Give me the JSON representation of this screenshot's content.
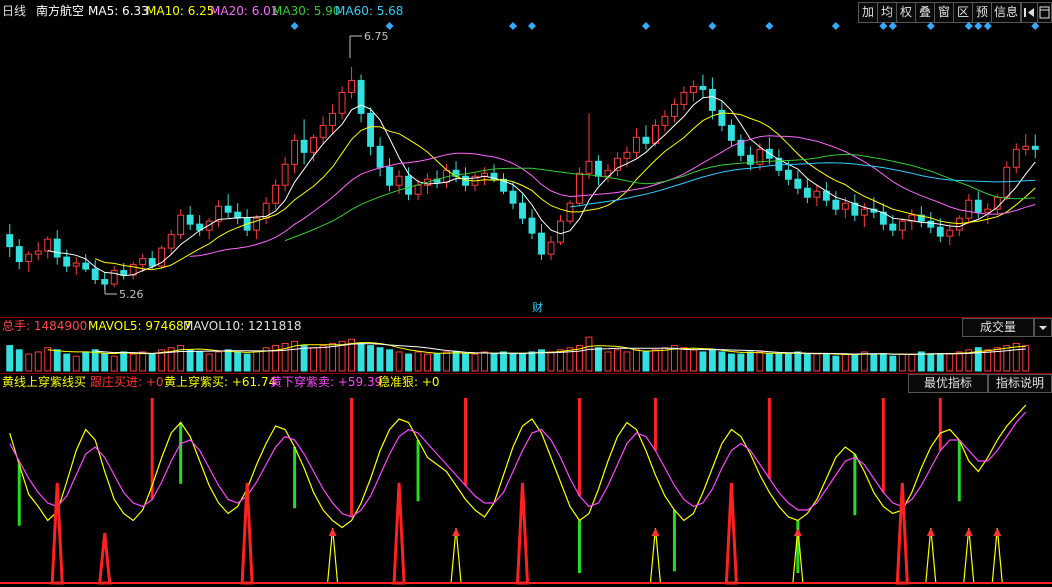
{
  "window": {
    "period": "日线",
    "stock_name": "南方航空"
  },
  "ma_legend": [
    {
      "label": "MA5: 6.33",
      "color": "#ffffff"
    },
    {
      "label": "MA10: 6.25",
      "color": "#ffff00"
    },
    {
      "label": "MA20: 6.01",
      "color": "#ff66ff"
    },
    {
      "label": "MA30: 5.90",
      "color": "#33cc33"
    },
    {
      "label": "MA60: 5.68",
      "color": "#33ccff"
    }
  ],
  "toolbar": {
    "add_label": "加",
    "avg_label": "均",
    "rights_label": "权",
    "overlay_label": "叠",
    "window_label": "窗",
    "range_label": "区",
    "forecast_label": "预",
    "info_label": "信息"
  },
  "chart_data": [
    {
      "type": "candlestick",
      "title": "南方航空",
      "annotations": [
        "6.75",
        "5.26",
        "财"
      ],
      "price_labels": {
        "high": "6.75",
        "low": "5.26"
      },
      "event_marker": "财",
      "ohlc": [
        [
          5.63,
          5.7,
          5.48,
          5.55
        ],
        [
          5.55,
          5.6,
          5.4,
          5.45
        ],
        [
          5.45,
          5.52,
          5.38,
          5.5
        ],
        [
          5.5,
          5.58,
          5.46,
          5.52
        ],
        [
          5.52,
          5.62,
          5.47,
          5.6
        ],
        [
          5.6,
          5.66,
          5.43,
          5.48
        ],
        [
          5.48,
          5.53,
          5.38,
          5.42
        ],
        [
          5.42,
          5.48,
          5.36,
          5.44
        ],
        [
          5.44,
          5.5,
          5.38,
          5.4
        ],
        [
          5.4,
          5.46,
          5.3,
          5.33
        ],
        [
          5.33,
          5.38,
          5.26,
          5.3
        ],
        [
          5.3,
          5.42,
          5.28,
          5.39
        ],
        [
          5.39,
          5.44,
          5.33,
          5.36
        ],
        [
          5.36,
          5.45,
          5.33,
          5.43
        ],
        [
          5.43,
          5.5,
          5.38,
          5.47
        ],
        [
          5.47,
          5.52,
          5.4,
          5.42
        ],
        [
          5.42,
          5.56,
          5.4,
          5.54
        ],
        [
          5.54,
          5.66,
          5.5,
          5.63
        ],
        [
          5.63,
          5.8,
          5.6,
          5.76
        ],
        [
          5.76,
          5.82,
          5.66,
          5.7
        ],
        [
          5.7,
          5.76,
          5.62,
          5.66
        ],
        [
          5.66,
          5.74,
          5.6,
          5.72
        ],
        [
          5.72,
          5.86,
          5.68,
          5.82
        ],
        [
          5.82,
          5.9,
          5.74,
          5.78
        ],
        [
          5.78,
          5.84,
          5.7,
          5.74
        ],
        [
          5.74,
          5.8,
          5.62,
          5.66
        ],
        [
          5.66,
          5.76,
          5.6,
          5.74
        ],
        [
          5.74,
          5.88,
          5.7,
          5.84
        ],
        [
          5.84,
          6.0,
          5.8,
          5.96
        ],
        [
          5.96,
          6.15,
          5.92,
          6.1
        ],
        [
          6.1,
          6.3,
          6.04,
          6.26
        ],
        [
          6.26,
          6.4,
          6.1,
          6.18
        ],
        [
          6.18,
          6.3,
          6.12,
          6.28
        ],
        [
          6.28,
          6.42,
          6.24,
          6.36
        ],
        [
          6.36,
          6.5,
          6.3,
          6.44
        ],
        [
          6.44,
          6.62,
          6.4,
          6.58
        ],
        [
          6.58,
          6.75,
          6.54,
          6.66
        ],
        [
          6.66,
          6.7,
          6.38,
          6.44
        ],
        [
          6.44,
          6.48,
          6.16,
          6.22
        ],
        [
          6.22,
          6.28,
          6.02,
          6.08
        ],
        [
          6.08,
          6.14,
          5.92,
          5.96
        ],
        [
          5.96,
          6.06,
          5.9,
          6.02
        ],
        [
          6.02,
          6.08,
          5.86,
          5.9
        ],
        [
          5.9,
          6.0,
          5.86,
          5.96
        ],
        [
          5.96,
          6.04,
          5.9,
          6.0
        ],
        [
          6.0,
          6.06,
          5.94,
          5.98
        ],
        [
          5.98,
          6.1,
          5.94,
          6.06
        ],
        [
          6.06,
          6.12,
          5.98,
          6.02
        ],
        [
          6.02,
          6.08,
          5.92,
          5.96
        ],
        [
          5.96,
          6.04,
          5.92,
          6.02
        ],
        [
          6.02,
          6.08,
          5.96,
          6.04
        ],
        [
          6.04,
          6.1,
          5.98,
          6.0
        ],
        [
          6.0,
          6.04,
          5.9,
          5.92
        ],
        [
          5.92,
          5.98,
          5.8,
          5.84
        ],
        [
          5.84,
          5.9,
          5.7,
          5.74
        ],
        [
          5.74,
          5.8,
          5.6,
          5.64
        ],
        [
          5.64,
          5.7,
          5.46,
          5.5
        ],
        [
          5.5,
          5.62,
          5.46,
          5.58
        ],
        [
          5.58,
          5.76,
          5.56,
          5.72
        ],
        [
          5.72,
          5.86,
          5.7,
          5.84
        ],
        [
          5.84,
          6.08,
          5.82,
          6.04
        ],
        [
          6.04,
          6.44,
          6.0,
          6.12
        ],
        [
          6.12,
          6.16,
          5.96,
          6.02
        ],
        [
          6.02,
          6.1,
          5.98,
          6.06
        ],
        [
          6.06,
          6.18,
          6.02,
          6.14
        ],
        [
          6.14,
          6.22,
          6.08,
          6.18
        ],
        [
          6.18,
          6.34,
          6.14,
          6.28
        ],
        [
          6.28,
          6.36,
          6.2,
          6.24
        ],
        [
          6.24,
          6.4,
          6.22,
          6.36
        ],
        [
          6.36,
          6.46,
          6.32,
          6.42
        ],
        [
          6.42,
          6.54,
          6.38,
          6.5
        ],
        [
          6.5,
          6.62,
          6.46,
          6.58
        ],
        [
          6.58,
          6.66,
          6.52,
          6.62
        ],
        [
          6.62,
          6.7,
          6.54,
          6.6
        ],
        [
          6.6,
          6.68,
          6.4,
          6.46
        ],
        [
          6.46,
          6.52,
          6.32,
          6.36
        ],
        [
          6.36,
          6.4,
          6.22,
          6.26
        ],
        [
          6.26,
          6.3,
          6.12,
          6.16
        ],
        [
          6.16,
          6.22,
          6.06,
          6.1
        ],
        [
          6.1,
          6.24,
          6.06,
          6.2
        ],
        [
          6.2,
          6.28,
          6.1,
          6.14
        ],
        [
          6.14,
          6.2,
          6.02,
          6.06
        ],
        [
          6.06,
          6.12,
          5.96,
          6.0
        ],
        [
          6.0,
          6.06,
          5.9,
          5.94
        ],
        [
          5.94,
          6.0,
          5.84,
          5.88
        ],
        [
          5.88,
          5.96,
          5.82,
          5.92
        ],
        [
          5.92,
          5.98,
          5.82,
          5.86
        ],
        [
          5.86,
          5.92,
          5.76,
          5.8
        ],
        [
          5.8,
          5.88,
          5.74,
          5.84
        ],
        [
          5.84,
          5.9,
          5.72,
          5.76
        ],
        [
          5.76,
          5.84,
          5.68,
          5.8
        ],
        [
          5.8,
          5.88,
          5.74,
          5.78
        ],
        [
          5.78,
          5.84,
          5.66,
          5.7
        ],
        [
          5.7,
          5.76,
          5.62,
          5.66
        ],
        [
          5.66,
          5.74,
          5.6,
          5.72
        ],
        [
          5.72,
          5.8,
          5.66,
          5.76
        ],
        [
          5.76,
          5.82,
          5.68,
          5.72
        ],
        [
          5.72,
          5.78,
          5.64,
          5.68
        ],
        [
          5.68,
          5.74,
          5.58,
          5.62
        ],
        [
          5.62,
          5.7,
          5.56,
          5.66
        ],
        [
          5.66,
          5.76,
          5.62,
          5.74
        ],
        [
          5.74,
          5.9,
          5.7,
          5.86
        ],
        [
          5.86,
          5.92,
          5.74,
          5.78
        ],
        [
          5.78,
          5.84,
          5.7,
          5.8
        ],
        [
          5.8,
          5.9,
          5.76,
          5.88
        ],
        [
          5.88,
          6.12,
          5.86,
          6.08
        ],
        [
          6.08,
          6.24,
          6.04,
          6.2
        ],
        [
          6.2,
          6.3,
          6.16,
          6.22
        ],
        [
          6.22,
          6.3,
          6.14,
          6.2
        ]
      ]
    },
    {
      "type": "bar",
      "title": "成交量",
      "legend": {
        "total_label": "总手: 1484900",
        "mavol5_label": "MAVOL5: 974687",
        "mavol10_label": "MAVOL10: 1211818",
        "selector_label": "成交量"
      },
      "values": [
        12,
        10,
        8,
        9,
        11,
        10,
        8,
        7,
        9,
        10,
        8,
        7,
        9,
        8,
        9,
        8,
        10,
        11,
        12,
        10,
        9,
        8,
        9,
        10,
        9,
        8,
        9,
        11,
        12,
        13,
        14,
        12,
        11,
        12,
        13,
        14,
        15,
        13,
        12,
        11,
        10,
        9,
        8,
        9,
        8,
        8,
        9,
        9,
        8,
        8,
        9,
        8,
        9,
        8,
        8,
        9,
        10,
        9,
        10,
        11,
        12,
        16,
        11,
        9,
        10,
        9,
        10,
        9,
        10,
        11,
        12,
        11,
        10,
        9,
        10,
        9,
        8,
        8,
        9,
        9,
        8,
        8,
        8,
        9,
        8,
        8,
        8,
        7,
        8,
        8,
        9,
        8,
        8,
        7,
        8,
        8,
        9,
        8,
        8,
        8,
        9,
        10,
        11,
        10,
        11,
        12,
        13,
        12
      ]
    },
    {
      "type": "line",
      "title": "黄线上穿紫线买",
      "legend": {
        "title_label": "黄线上穿紫线买",
        "follow_label": "跟庄买进: +0",
        "yellow_cross_label": "黄上穿紫买: +61.74",
        "yellow_down_label": "黄下穿紫卖: +59.39",
        "steady_label": "稳准狠: +0",
        "best_button": "最优指标",
        "help_button": "指标说明"
      },
      "series": [
        {
          "name": "黄线上穿紫线买",
          "color": "#ffff00",
          "values": [
            80,
            62,
            45,
            38,
            30,
            35,
            52,
            70,
            82,
            76,
            58,
            42,
            34,
            30,
            36,
            50,
            66,
            80,
            86,
            78,
            64,
            50,
            40,
            34,
            38,
            48,
            62,
            74,
            84,
            82,
            72,
            60,
            46,
            36,
            30,
            26,
            30,
            40,
            54,
            70,
            82,
            88,
            86,
            76,
            66,
            62,
            58,
            50,
            42,
            36,
            32,
            40,
            56,
            72,
            84,
            88,
            80,
            66,
            52,
            38,
            30,
            34,
            48,
            64,
            78,
            86,
            82,
            70,
            56,
            44,
            36,
            30,
            34,
            46,
            60,
            74,
            82,
            78,
            68,
            56,
            46,
            38,
            32,
            30,
            34,
            42,
            54,
            66,
            72,
            68,
            58,
            46,
            38,
            34,
            36,
            46,
            60,
            72,
            80,
            82,
            76,
            64,
            58,
            66,
            76,
            84,
            90,
            96
          ]
        },
        {
          "name": "紫线",
          "color": "#ff44ff",
          "values": [
            74,
            64,
            54,
            46,
            40,
            38,
            44,
            56,
            68,
            72,
            66,
            56,
            46,
            40,
            38,
            42,
            52,
            64,
            74,
            76,
            70,
            60,
            50,
            42,
            40,
            44,
            52,
            62,
            72,
            78,
            76,
            68,
            58,
            48,
            40,
            34,
            32,
            36,
            44,
            56,
            68,
            78,
            82,
            80,
            74,
            68,
            62,
            56,
            50,
            44,
            40,
            40,
            46,
            58,
            70,
            80,
            82,
            76,
            66,
            54,
            44,
            38,
            40,
            50,
            62,
            74,
            80,
            78,
            70,
            60,
            50,
            42,
            38,
            40,
            48,
            60,
            70,
            74,
            70,
            62,
            54,
            46,
            40,
            36,
            36,
            40,
            48,
            56,
            64,
            66,
            62,
            54,
            46,
            40,
            38,
            42,
            50,
            60,
            70,
            76,
            76,
            70,
            64,
            64,
            70,
            78,
            86,
            92
          ]
        }
      ],
      "red_bars": [
        15,
        36,
        48,
        60,
        68,
        80,
        92,
        98
      ],
      "green_bars": [
        1,
        18,
        30,
        43,
        60,
        70,
        83,
        89,
        100
      ]
    }
  ]
}
